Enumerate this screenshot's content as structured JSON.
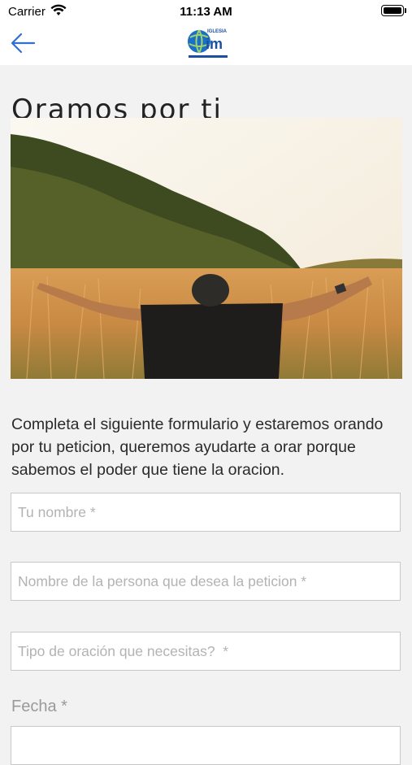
{
  "status_bar": {
    "carrier": "Carrier",
    "time": "11:13 AM"
  },
  "nav": {
    "logo_text_top": "IGLESIA",
    "logo_text_main": "im"
  },
  "page": {
    "title": "Oramos por ti"
  },
  "description": "Completa el siguiente formulario y estaremos orando por tu peticion, queremos ayudarte a orar porque sabemos el poder que tiene la oracion.",
  "form": {
    "name_placeholder": "Tu nombre *",
    "person_placeholder": "Nombre de la persona que desea la peticion *",
    "type_placeholder": "Tipo de oración que necesitas?  *",
    "date_label": "Fecha *"
  },
  "colors": {
    "accent": "#2f6fd6",
    "background": "#f2f2f2"
  }
}
